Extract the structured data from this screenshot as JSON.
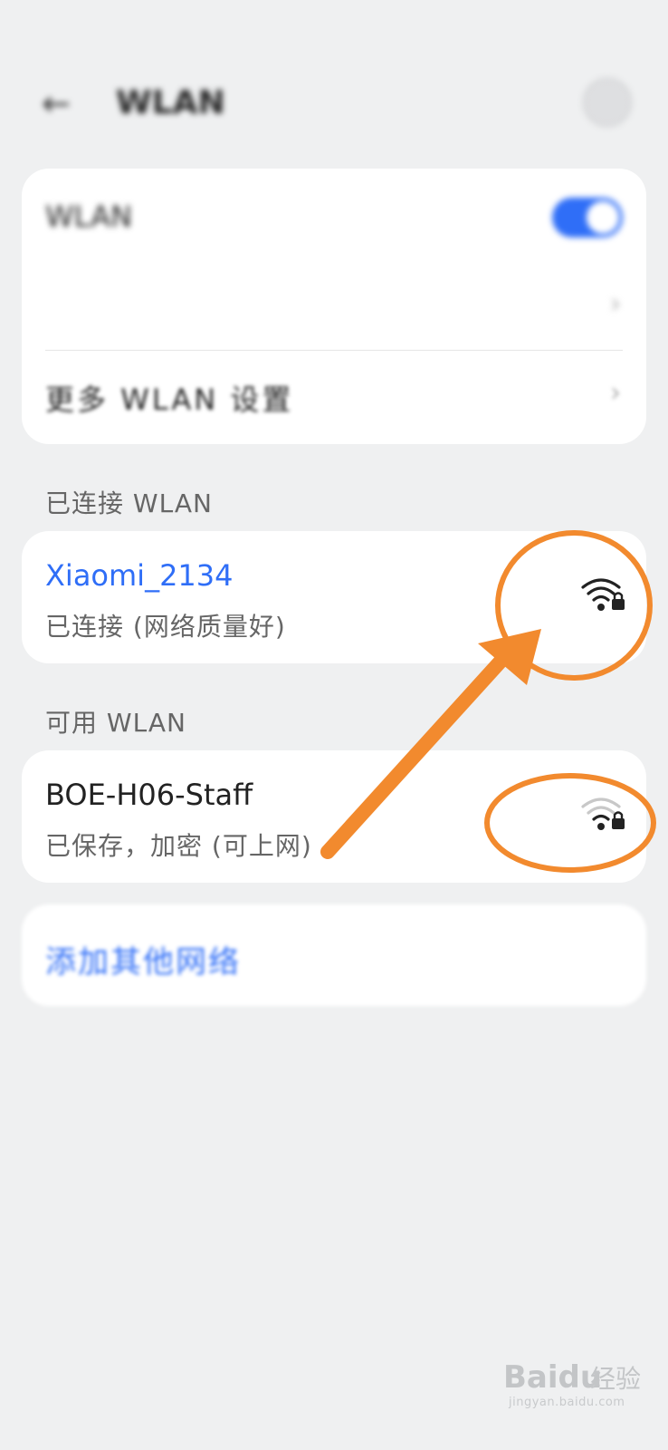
{
  "status_bar": {
    "left_text": "",
    "right_text": ""
  },
  "header": {
    "title": "WLAN"
  },
  "settings": {
    "wlan_toggle_label": "WLAN",
    "wlan_enabled": true,
    "network_acceleration_label": "",
    "network_acceleration_value": "",
    "more_settings_label": "更多 WLAN 设置"
  },
  "connected_section": {
    "heading": "已连接 WLAN",
    "network": {
      "name": "Xiaomi_2134",
      "status": "已连接 (网络质量好)",
      "icon": "wifi-lock-icon"
    }
  },
  "available_section": {
    "heading": "可用 WLAN",
    "networks": [
      {
        "name": "BOE-H06-Staff",
        "status": "已保存，加密 (可上网)",
        "icon": "wifi-lock-icon"
      }
    ]
  },
  "add_network": {
    "label": "添加其他网络"
  },
  "annotation": {
    "color": "#f28a2e"
  },
  "watermark": {
    "brand": "Baidu",
    "brand_cn": "经验",
    "url": "jingyan.baidu.com"
  },
  "colors": {
    "accent": "#2f6ef7",
    "background": "#eff0f1",
    "card": "#ffffff"
  }
}
